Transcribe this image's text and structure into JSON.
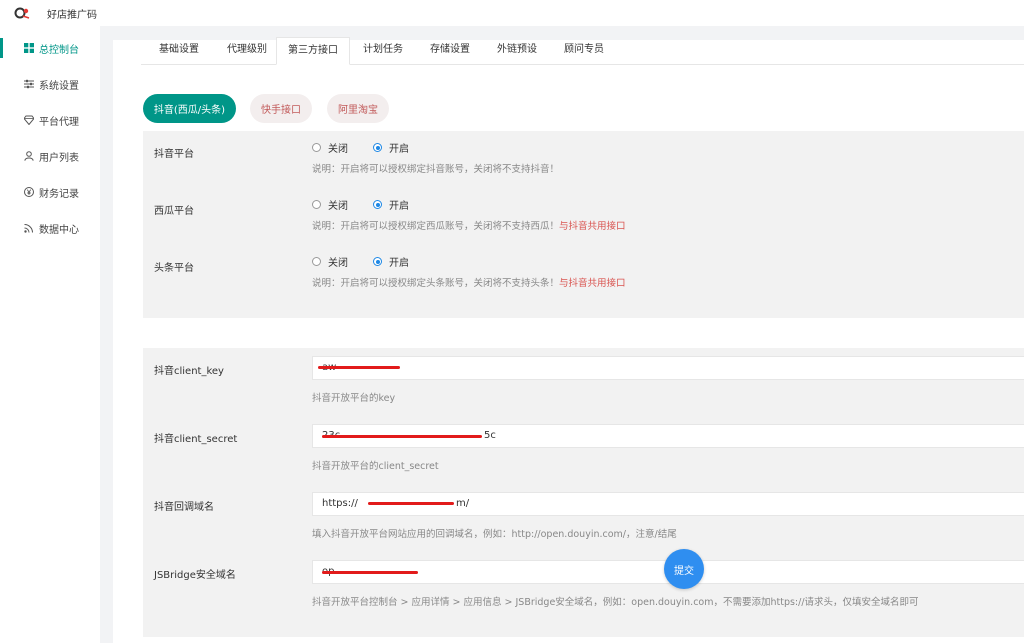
{
  "app": {
    "title": "好店推广码"
  },
  "sidebar": {
    "items": [
      {
        "label": "总控制台",
        "icon": "dashboard-icon"
      },
      {
        "label": "系统设置",
        "icon": "sliders-icon"
      },
      {
        "label": "平台代理",
        "icon": "diamond-icon"
      },
      {
        "label": "用户列表",
        "icon": "user-icon"
      },
      {
        "label": "财务记录",
        "icon": "yen-icon"
      },
      {
        "label": "数据中心",
        "icon": "rss-icon"
      }
    ]
  },
  "tabs": [
    "基础设置",
    "代理级别",
    "第三方接口",
    "计划任务",
    "存储设置",
    "外链预设",
    "顾问专员"
  ],
  "subtabs": [
    "抖音(西瓜/头条)",
    "快手接口",
    "阿里淘宝"
  ],
  "platforms": {
    "off_label": "关闭",
    "on_label": "开启",
    "douyin": {
      "label": "抖音平台",
      "desc": "说明：开启将可以授权绑定抖音账号，关闭将不支持抖音！"
    },
    "xigua": {
      "label": "西瓜平台",
      "desc": "说明：开启将可以授权绑定西瓜账号，关闭将不支持西瓜！",
      "highlight": "与抖音共用接口"
    },
    "toutiao": {
      "label": "头条平台",
      "desc": "说明：开启将可以授权绑定头条账号，关闭将不支持头条！",
      "highlight": "与抖音共用接口"
    }
  },
  "config": {
    "client_key": {
      "label": "抖音client_key",
      "value": "aw",
      "help": "抖音开放平台的key"
    },
    "client_secret": {
      "label": "抖音client_secret",
      "value": "23c",
      "value_end": "5c",
      "help": "抖音开放平台的client_secret"
    },
    "callback": {
      "label": "抖音回调域名",
      "value": "https://",
      "value_end": "m/",
      "help": "填入抖音开放平台网站应用的回调域名，例如：http://open.douyin.com/，注意/结尾"
    },
    "jsbridge": {
      "label": "JSBridge安全域名",
      "value": "op",
      "help": "抖音开放平台控制台 > 应用详情 > 应用信息 > JSBridge安全域名，例如：open.douyin.com，不需要添加https://请求头，仅填安全域名即可"
    }
  },
  "actions": {
    "submit": "提交"
  },
  "colors": {
    "accent": "#009688",
    "primary_blue": "#2f8ef0",
    "highlight_red": "#d9534f"
  }
}
